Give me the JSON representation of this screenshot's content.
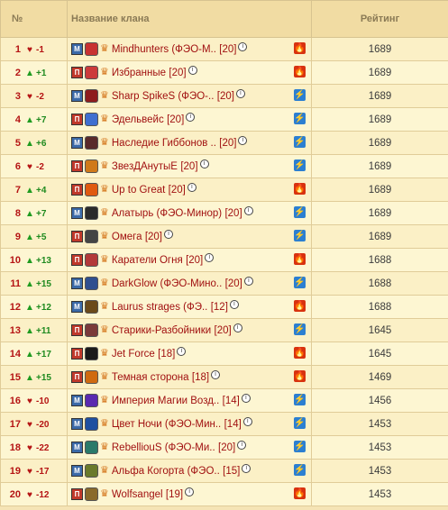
{
  "header": {
    "rank_label": "№",
    "name_label": "Название клана",
    "rating_label": "Рейтинг"
  },
  "rows": [
    {
      "rank": "1",
      "trend": "down",
      "change": "-1",
      "faction": "М",
      "emblem_color": "#c83232",
      "name": "Mindhunters (ФЭО-М..",
      "level": "[20]",
      "element": "fire",
      "rating": "1689"
    },
    {
      "rank": "2",
      "trend": "up",
      "change": "+1",
      "faction": "П",
      "emblem_color": "#cc3b3b",
      "name": "Избранные",
      "level": "[20]",
      "element": "fire",
      "rating": "1689"
    },
    {
      "rank": "3",
      "trend": "down",
      "change": "-2",
      "faction": "М",
      "emblem_color": "#8e1c1c",
      "name": "Sharp SpikeS (ФЭО-..",
      "level": "[20]",
      "element": "lightning",
      "rating": "1689"
    },
    {
      "rank": "4",
      "trend": "up",
      "change": "+7",
      "faction": "П",
      "emblem_color": "#3f6fd0",
      "name": "Эдельвейс",
      "level": "[20]",
      "element": "lightning",
      "rating": "1689"
    },
    {
      "rank": "5",
      "trend": "up",
      "change": "+6",
      "faction": "М",
      "emblem_color": "#5a2a2a",
      "name": "Наследие Гиббонов ..",
      "level": "[20]",
      "element": "lightning",
      "rating": "1689"
    },
    {
      "rank": "6",
      "trend": "down",
      "change": "-2",
      "faction": "П",
      "emblem_color": "#d07a1a",
      "name": "ЗвезДАнутыЕ",
      "level": "[20]",
      "element": "lightning",
      "rating": "1689"
    },
    {
      "rank": "7",
      "trend": "up",
      "change": "+4",
      "faction": "П",
      "emblem_color": "#e05a10",
      "name": "Up to Great",
      "level": "[20]",
      "element": "fire",
      "rating": "1689"
    },
    {
      "rank": "8",
      "trend": "up",
      "change": "+7",
      "faction": "М",
      "emblem_color": "#2a2a2a",
      "name": "Алатырь (ФЭО-Минор)",
      "level": "[20]",
      "element": "lightning",
      "rating": "1689"
    },
    {
      "rank": "9",
      "trend": "up",
      "change": "+5",
      "faction": "П",
      "emblem_color": "#444444",
      "name": "Омега",
      "level": "[20]",
      "element": "lightning",
      "rating": "1689"
    },
    {
      "rank": "10",
      "trend": "up",
      "change": "+13",
      "faction": "П",
      "emblem_color": "#b33a3a",
      "name": "Каратели Огня",
      "level": "[20]",
      "element": "fire",
      "rating": "1688"
    },
    {
      "rank": "11",
      "trend": "up",
      "change": "+15",
      "faction": "М",
      "emblem_color": "#2f4f8f",
      "name": "DarkGlow (ФЭО-Мино..",
      "level": "[20]",
      "element": "lightning",
      "rating": "1688"
    },
    {
      "rank": "12",
      "trend": "up",
      "change": "+12",
      "faction": "М",
      "emblem_color": "#6b4a1a",
      "name": "Laurus strages (ФЭ..",
      "level": "[12]",
      "element": "fire",
      "rating": "1688"
    },
    {
      "rank": "13",
      "trend": "up",
      "change": "+11",
      "faction": "П",
      "emblem_color": "#7a3a3a",
      "name": "Старики-Разбойники",
      "level": "[20]",
      "element": "lightning",
      "rating": "1645"
    },
    {
      "rank": "14",
      "trend": "up",
      "change": "+17",
      "faction": "П",
      "emblem_color": "#1a1a1a",
      "name": "Jet Force",
      "level": "[18]",
      "element": "fire",
      "rating": "1645"
    },
    {
      "rank": "15",
      "trend": "up",
      "change": "+15",
      "faction": "П",
      "emblem_color": "#d06a10",
      "name": "Темная сторона",
      "level": "[18]",
      "element": "fire",
      "rating": "1469"
    },
    {
      "rank": "16",
      "trend": "down",
      "change": "-10",
      "faction": "М",
      "emblem_color": "#5a2ab0",
      "name": "Империя Магии Возд..",
      "level": "[14]",
      "element": "lightning",
      "rating": "1456"
    },
    {
      "rank": "17",
      "trend": "down",
      "change": "-20",
      "faction": "М",
      "emblem_color": "#1f4fa0",
      "name": "Цвет Ночи (ФЭО-Мин..",
      "level": "[14]",
      "element": "lightning",
      "rating": "1453"
    },
    {
      "rank": "18",
      "trend": "down",
      "change": "-22",
      "faction": "М",
      "emblem_color": "#2a7a6a",
      "name": "RebellіouS (ФЭО-Ми..",
      "level": "[20]",
      "element": "lightning",
      "rating": "1453"
    },
    {
      "rank": "19",
      "trend": "down",
      "change": "-17",
      "faction": "М",
      "emblem_color": "#6a7a2a",
      "name": "Альфа Когорта (ФЭО..",
      "level": "[15]",
      "element": "lightning",
      "rating": "1453"
    },
    {
      "rank": "20",
      "trend": "down",
      "change": "-12",
      "faction": "П",
      "emblem_color": "#8a6a2a",
      "name": "Wolfsangel",
      "level": "[19]",
      "element": "fire",
      "rating": "1453"
    }
  ],
  "icons": {
    "up": "trend-up-arrow-icon",
    "down": "trend-down-heart-icon",
    "crown": "crown-icon",
    "info": "info-icon",
    "fire": "fire-element-icon",
    "lightning": "lightning-element-icon"
  }
}
